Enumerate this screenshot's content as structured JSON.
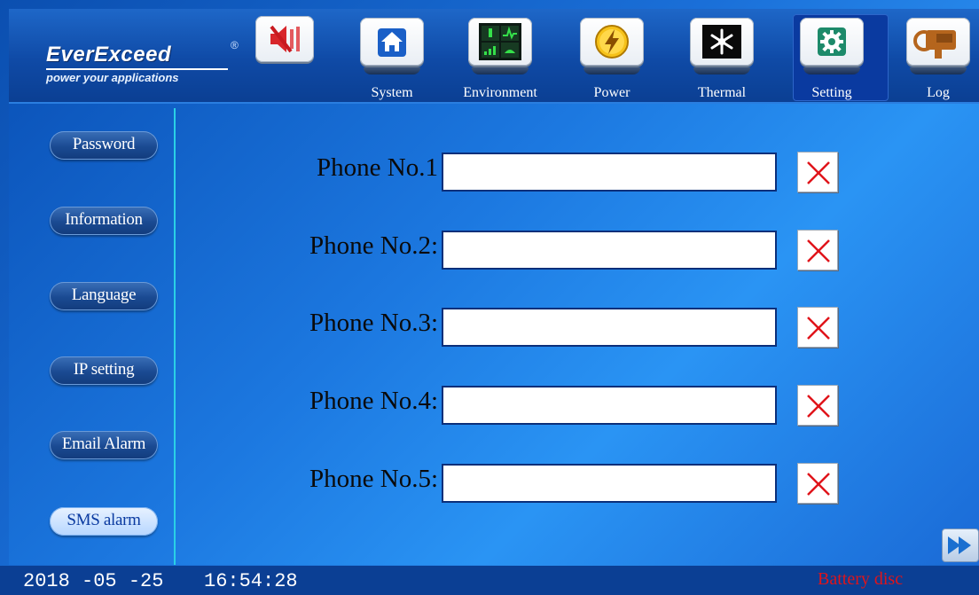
{
  "brand": {
    "name": "EverExceed",
    "registered": "®",
    "tagline": "power your applications"
  },
  "nav": {
    "tabs": [
      {
        "label": "System",
        "icon": "home-icon"
      },
      {
        "label": "Environment",
        "icon": "environment-icon"
      },
      {
        "label": "Power",
        "icon": "lightning-icon"
      },
      {
        "label": "Thermal",
        "icon": "snowflake-icon"
      },
      {
        "label": "Setting",
        "icon": "gear-icon",
        "active": true
      },
      {
        "label": "Log",
        "icon": "log-icon"
      }
    ],
    "mute_icon": "speaker-mute-icon"
  },
  "sidebar": {
    "items": [
      {
        "label": "Password"
      },
      {
        "label": "Information"
      },
      {
        "label": "Language"
      },
      {
        "label": "IP setting"
      },
      {
        "label": "Email Alarm"
      },
      {
        "label": "SMS alarm",
        "active": true
      }
    ]
  },
  "phones": [
    {
      "label": "Phone No.1",
      "value": ""
    },
    {
      "label": "Phone No.2:",
      "value": ""
    },
    {
      "label": "Phone No.3:",
      "value": ""
    },
    {
      "label": "Phone No.4:",
      "value": ""
    },
    {
      "label": "Phone No.5:",
      "value": ""
    }
  ],
  "status": {
    "date": "2018 -05 -25",
    "time": "16:54:28",
    "alarm": "Battery disc"
  },
  "colors": {
    "alarm": "#e0141a",
    "accent": "#2ad0e6",
    "delete": "#e0141a"
  }
}
